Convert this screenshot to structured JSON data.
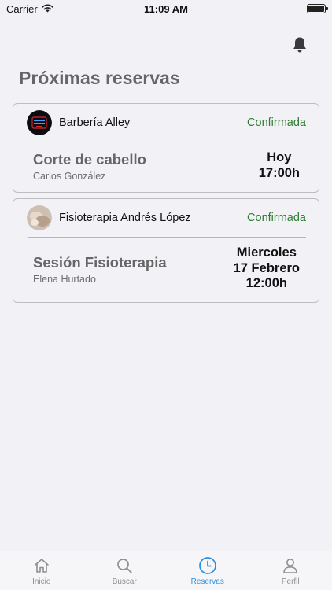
{
  "status_bar": {
    "carrier": "Carrier",
    "time": "11:09 AM"
  },
  "header": {
    "title": "Próximas reservas"
  },
  "bookings": [
    {
      "business": "Barbería Alley",
      "status": "Confirmada",
      "service": "Corte de cabello",
      "staff": "Carlos González",
      "when_line1": "Hoy",
      "when_line2": "17:00h",
      "when_line3": ""
    },
    {
      "business": "Fisioterapia Andrés López",
      "status": "Confirmada",
      "service": "Sesión Fisioterapia",
      "staff": "Elena Hurtado",
      "when_line1": "Miercoles",
      "when_line2": "17 Febrero",
      "when_line3": "12:00h"
    }
  ],
  "tab_bar": {
    "tabs": [
      {
        "label": "Inicio",
        "icon": "home-icon"
      },
      {
        "label": "Buscar",
        "icon": "search-icon"
      },
      {
        "label": "Reservas",
        "icon": "clock-icon"
      },
      {
        "label": "Perfil",
        "icon": "person-icon"
      }
    ],
    "active": "Reservas"
  },
  "colors": {
    "background": "#f2f1f6",
    "confirmed": "#2e7d32",
    "active_tab": "#2a8de0",
    "inactive_tab": "#8e8e93"
  }
}
